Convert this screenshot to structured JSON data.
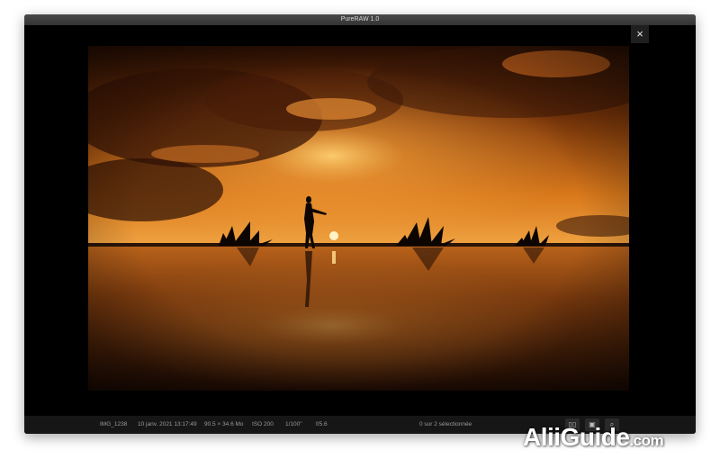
{
  "window": {
    "title": "PureRAW 1.0"
  },
  "toolbar": {
    "close_glyph": "×"
  },
  "photo": {
    "subject": "sunset-silhouette-photo"
  },
  "status": {
    "filename": "IMG_1238",
    "datetime": "10 janv. 2021 13:17:49",
    "filesize": "90.5 × 34.6 Mo",
    "iso": "ISO 200",
    "shutter": "1/100\"",
    "aperture": "f/5.6",
    "selection": "0 sur 2 sélectionnée"
  },
  "watermark": {
    "brand": "AliiGuide",
    "tld": ".com"
  }
}
